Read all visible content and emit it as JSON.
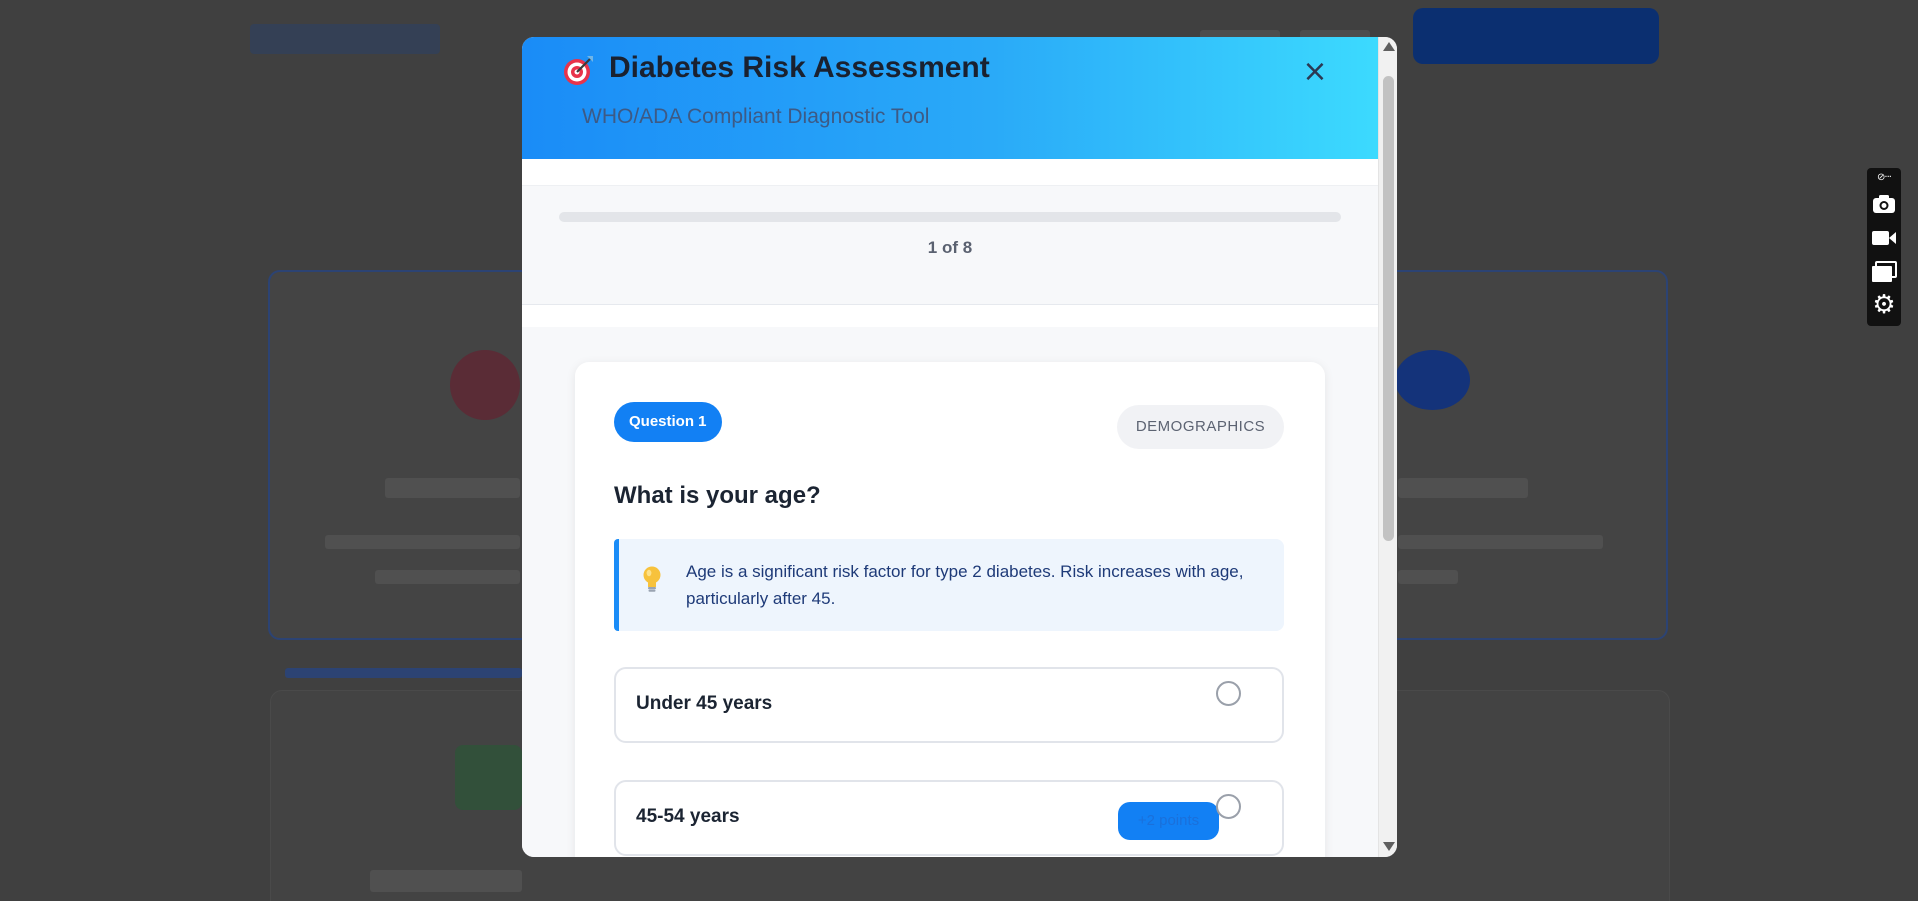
{
  "modal": {
    "title": "Diabetes Risk Assessment",
    "subtitle": "WHO/ADA Compliant Diagnostic Tool",
    "header_icon": "target-icon",
    "close_label": "×",
    "accent_color": "#1280f4"
  },
  "progress": {
    "text": "1 of 8",
    "current": 1,
    "total": 8,
    "fraction": 0
  },
  "question": {
    "badge": "Question 1",
    "category": "DEMOGRAPHICS",
    "title": "What is your age?",
    "info_icon": "lightbulb-icon",
    "info": "Age is a significant risk factor for type 2 diabetes. Risk increases with age, particularly after 45.",
    "options": [
      {
        "label": "Under 45 years",
        "points": ""
      },
      {
        "label": "45-54 years",
        "points": "+2 points"
      }
    ]
  },
  "toolbar": {
    "items": [
      "more-icon",
      "camera-icon",
      "video-icon",
      "window-icon",
      "gear-icon"
    ],
    "more_label": "⊘···"
  }
}
